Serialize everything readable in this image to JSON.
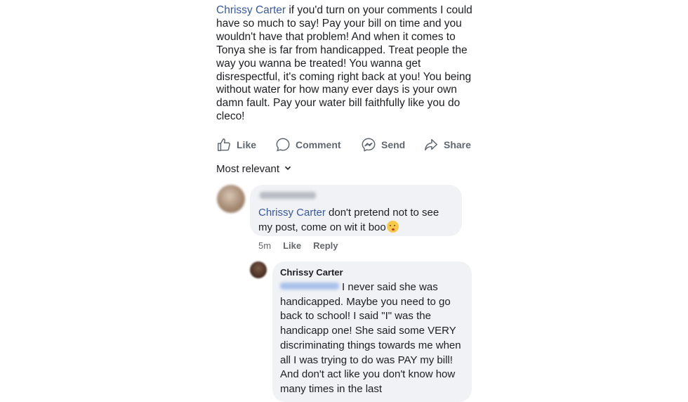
{
  "post": {
    "mention": "Chrissy Carter",
    "text": " if you'd turn on your comments I could have so much to say! Pay your bill on time and you wouldn't have that problem! And when it comes to Tonya she is far from handicapped. Treat people the way you wanna be treated! You wanna get disrespectful, it's coming right back at you! You being without water for how many ever days is your own damn fault. Pay your water bill faithfully like you do cleco!"
  },
  "actions": {
    "like": "Like",
    "comment": "Comment",
    "send": "Send",
    "share": "Share"
  },
  "sort": {
    "label": "Most relevant"
  },
  "comment1": {
    "mention": "Chrissy Carter",
    "text": " don't pretend not to see my post, come on wit it boo",
    "time": "5m",
    "like": "Like",
    "reply": "Reply"
  },
  "comment2": {
    "name": "Chrissy Carter",
    "text": "I never said she was handicapped. Maybe you need to go back to school! I said \"I\" was the handicapp one! She said some VERY discriminating things towards me when all I was trying to do was PAY my bill! And don't act like you don't know how many times in the last"
  },
  "colors": {
    "mention": "#385898",
    "bubble": "#f0f2f5",
    "meta": "#65676b"
  },
  "icons": [
    "like-thumb-icon",
    "comment-bubble-icon",
    "messenger-icon",
    "share-arrow-icon",
    "chevron-down-icon",
    "kissing-face-emoji"
  ]
}
